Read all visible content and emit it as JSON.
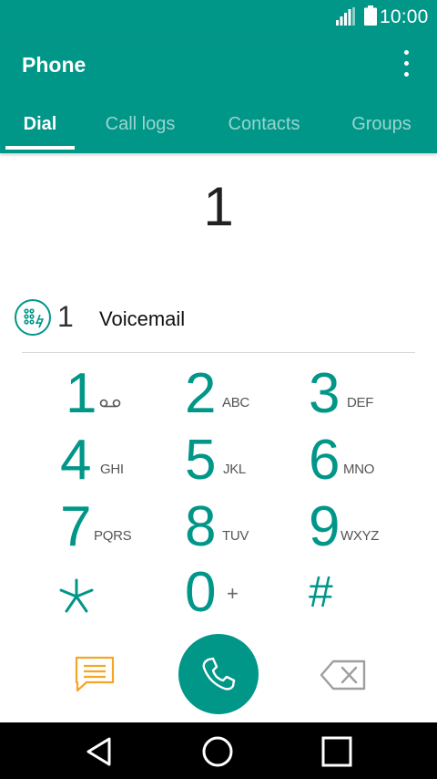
{
  "status_bar": {
    "time": "10:00",
    "signal_icon": "signal-icon",
    "battery_icon": "battery-icon"
  },
  "app_bar": {
    "title": "Phone",
    "overflow_icon": "more-vert-icon",
    "tabs": [
      {
        "label": "Dial",
        "active": true
      },
      {
        "label": "Call logs",
        "active": false
      },
      {
        "label": "Contacts",
        "active": false
      },
      {
        "label": "Groups",
        "active": false
      }
    ]
  },
  "dialer": {
    "entered_number": "1",
    "suggestion": {
      "icon": "voicemail-speed-dial-icon",
      "key": "1",
      "name": "Voicemail"
    },
    "keys": [
      {
        "digit": "1",
        "letters": "",
        "icon": "voicemail-icon"
      },
      {
        "digit": "2",
        "letters": "ABC"
      },
      {
        "digit": "3",
        "letters": "DEF"
      },
      {
        "digit": "4",
        "letters": "GHI"
      },
      {
        "digit": "5",
        "letters": "JKL"
      },
      {
        "digit": "6",
        "letters": "MNO"
      },
      {
        "digit": "7",
        "letters": "PQRS"
      },
      {
        "digit": "8",
        "letters": "TUV"
      },
      {
        "digit": "9",
        "letters": "WXYZ"
      },
      {
        "digit": "*",
        "letters": ""
      },
      {
        "digit": "0",
        "letters": "+"
      },
      {
        "digit": "#",
        "letters": ""
      }
    ],
    "actions": {
      "message_icon": "message-icon",
      "call_icon": "phone-call-icon",
      "backspace_icon": "backspace-icon"
    }
  },
  "nav_bar": {
    "back_icon": "back-icon",
    "home_icon": "home-icon",
    "recents_icon": "recents-icon"
  },
  "colors": {
    "primary": "#009688",
    "accent": "#f5a623",
    "nav_background": "#000000"
  }
}
